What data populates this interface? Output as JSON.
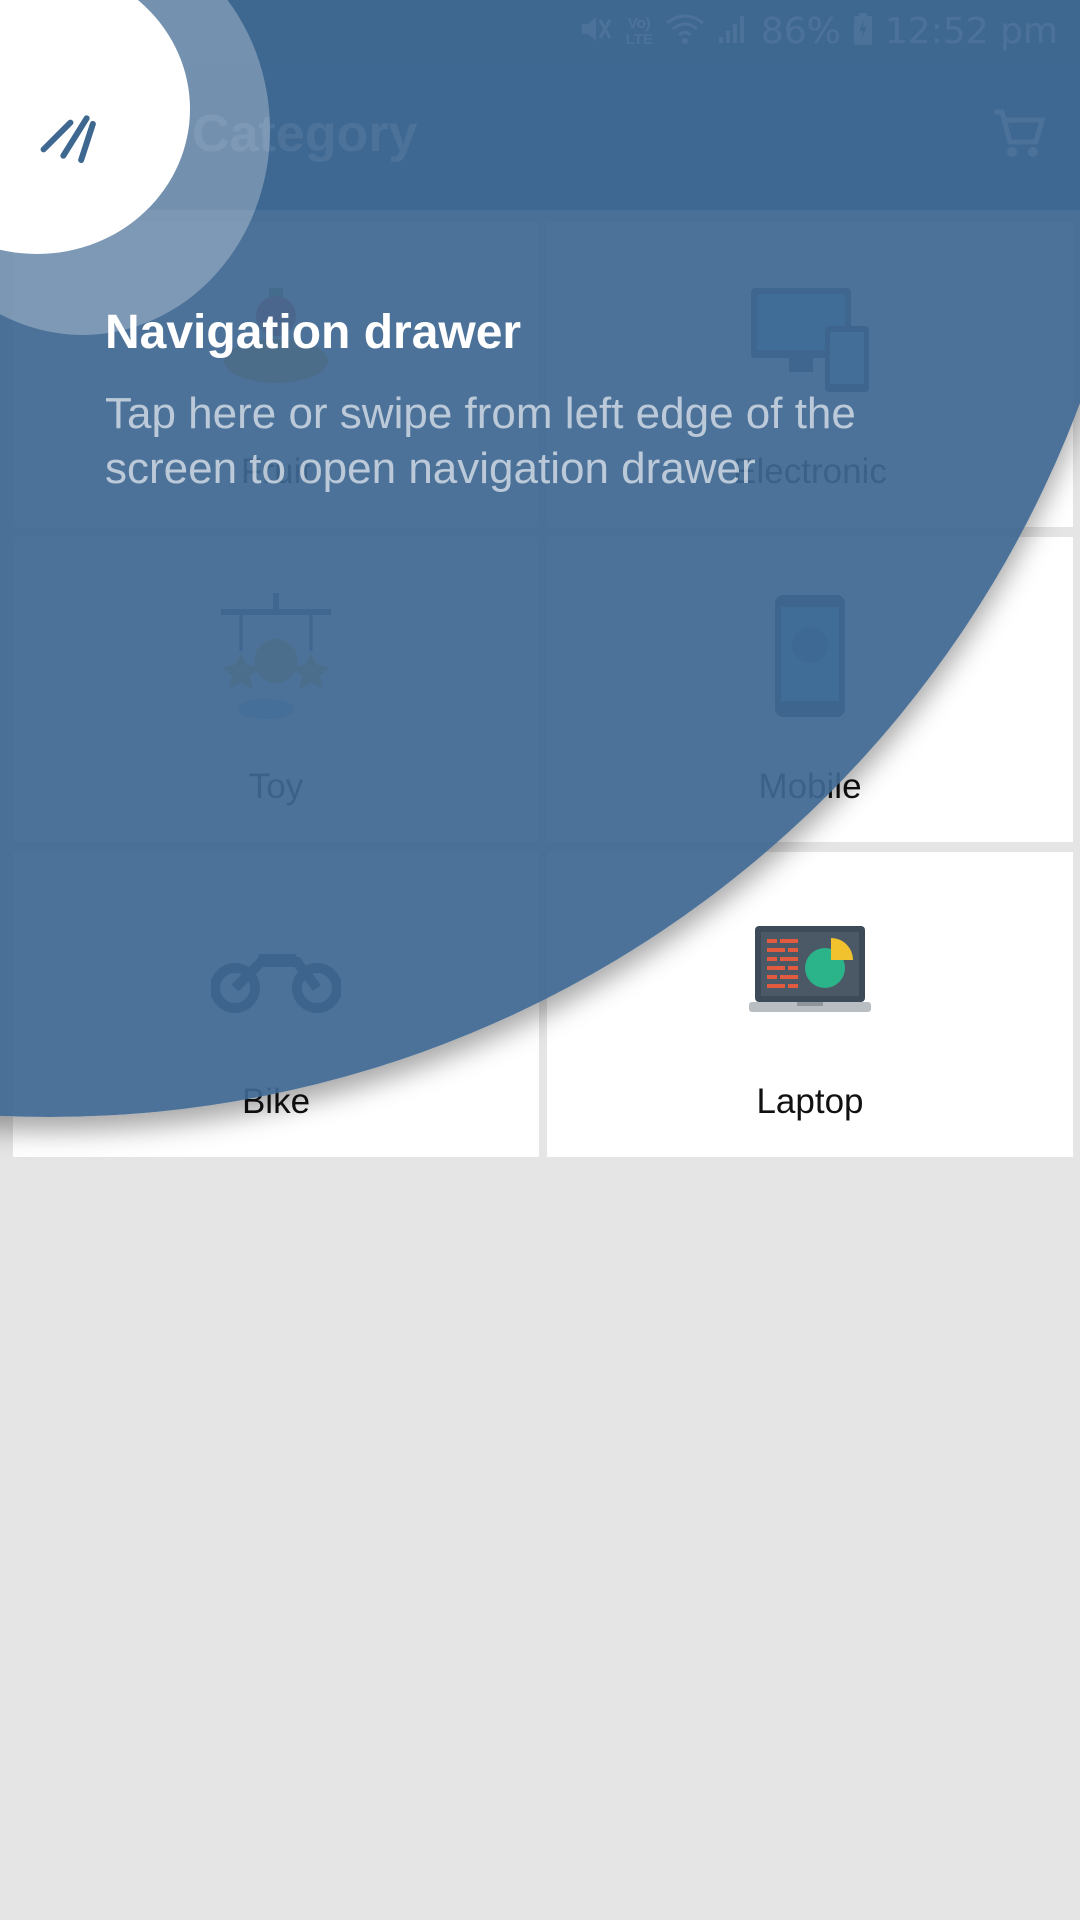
{
  "status_bar": {
    "battery": "86%",
    "time": "12:52 pm",
    "volte_top": "Vo)",
    "volte_bottom": "LTE"
  },
  "app_bar": {
    "title": "Category"
  },
  "categories": [
    {
      "label": "Fruit",
      "icon": "fruit-icon"
    },
    {
      "label": "Electronic",
      "icon": "electronic-devices-icon"
    },
    {
      "label": "Toy",
      "icon": "toy-mobile-icon"
    },
    {
      "label": "Mobile",
      "icon": "mobile-phone-icon"
    },
    {
      "label": "Bike",
      "icon": "motorbike-icon"
    },
    {
      "label": "Laptop",
      "icon": "laptop-chart-icon"
    }
  ],
  "tutorial": {
    "title": "Navigation drawer",
    "text": "Tap here or swipe from left edge of the screen to open navigation drawer"
  },
  "colors": {
    "overlay": "#3e6791",
    "status_bar": "#476f94",
    "background": "#e5e5e6"
  }
}
